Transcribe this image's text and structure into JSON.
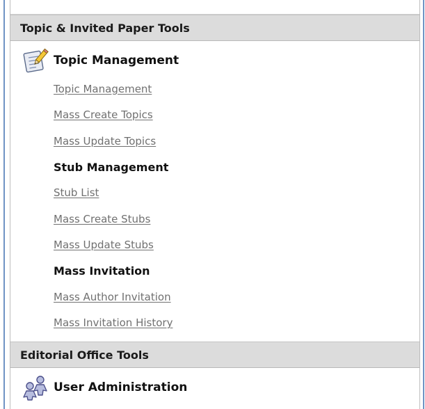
{
  "sections": [
    {
      "header": "Topic & Invited Paper Tools",
      "group": {
        "icon": "notepad-pencil-icon",
        "title": "Topic Management"
      },
      "topic_links": [
        "Topic Management",
        "Mass Create Topics",
        "Mass Update Topics"
      ],
      "stub_title": "Stub Management",
      "stub_links": [
        "Stub List",
        "Mass Create Stubs",
        "Mass Update Stubs"
      ],
      "invite_title": "Mass Invitation",
      "invite_links": [
        "Mass Author Invitation",
        "Mass Invitation History"
      ]
    },
    {
      "header": "Editorial Office Tools",
      "group": {
        "icon": "users-admin-icon",
        "title": "User Administration"
      }
    }
  ],
  "colors": {
    "accent_border": "#6f93c4",
    "header_bg": "#dcdcdc",
    "link": "#707070"
  }
}
